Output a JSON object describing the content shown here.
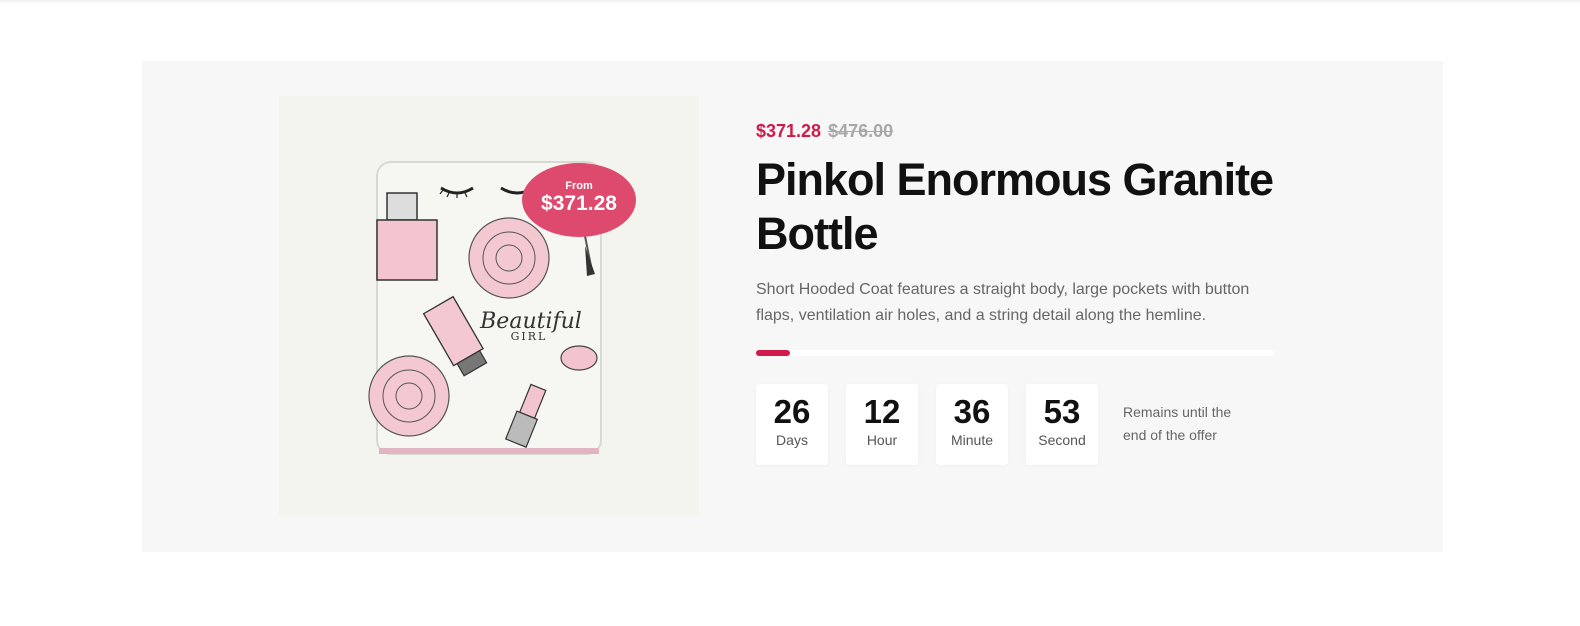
{
  "deal": {
    "badge": {
      "from_label": "From",
      "price": "$371.28"
    },
    "price_current": "$371.28",
    "price_old": "$476.00",
    "title": "Pinkol Enormous Granite Bottle",
    "description": "Short Hooded Coat features a straight body, large pockets with button flaps, ventilation air holes, and a string detail along the hemline.",
    "progress_fraction": 0.065,
    "countdown": [
      {
        "value": "26",
        "unit": "Days"
      },
      {
        "value": "12",
        "unit": "Hour"
      },
      {
        "value": "36",
        "unit": "Minute"
      },
      {
        "value": "53",
        "unit": "Second"
      }
    ],
    "remains_text": "Remains until the end of the offer",
    "image_text": {
      "script": "Beautiful",
      "sub": "GIRL"
    }
  },
  "colors": {
    "accent": "#cf1a4b",
    "badge": "#dd4a6d",
    "section_bg": "#f7f7f7",
    "old_price": "#a8a8a8"
  }
}
